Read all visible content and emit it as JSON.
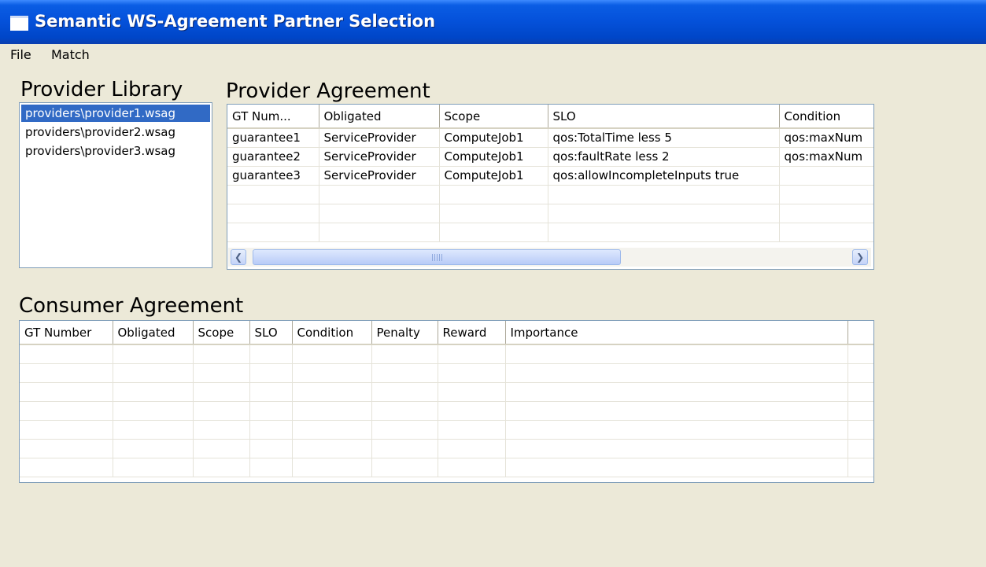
{
  "window": {
    "title": "Semantic WS-Agreement Partner Selection"
  },
  "menu": {
    "items": [
      "File",
      "Match"
    ]
  },
  "provider_library": {
    "title": "Provider Library",
    "items": [
      "providers\\provider1.wsag",
      "providers\\provider2.wsag",
      "providers\\provider3.wsag"
    ],
    "selected_index": 0
  },
  "provider_agreement": {
    "title": "Provider Agreement",
    "columns": [
      "GT Num...",
      "Obligated",
      "Scope",
      "SLO",
      "Condition"
    ],
    "rows": [
      [
        "guarantee1",
        "ServiceProvider",
        "ComputeJob1",
        "qos:TotalTime less 5",
        "qos:maxNum"
      ],
      [
        "guarantee2",
        "ServiceProvider",
        "ComputeJob1",
        "qos:faultRate less 2",
        "qos:maxNum"
      ],
      [
        "guarantee3",
        "ServiceProvider",
        "ComputeJob1",
        "qos:allowIncompleteInputs true",
        ""
      ]
    ]
  },
  "consumer_agreement": {
    "title": "Consumer Agreement",
    "columns": [
      "GT Number",
      "Obligated",
      "Scope",
      "SLO",
      "Condition",
      "Penalty",
      "Reward",
      "Importance"
    ],
    "rows": []
  },
  "colors": {
    "title_bar": "#0552db",
    "selection": "#316ac5",
    "window_bg": "#ece9d8"
  },
  "icons": {
    "scroll_left": "chevron-left-icon",
    "scroll_right": "chevron-right-icon"
  }
}
